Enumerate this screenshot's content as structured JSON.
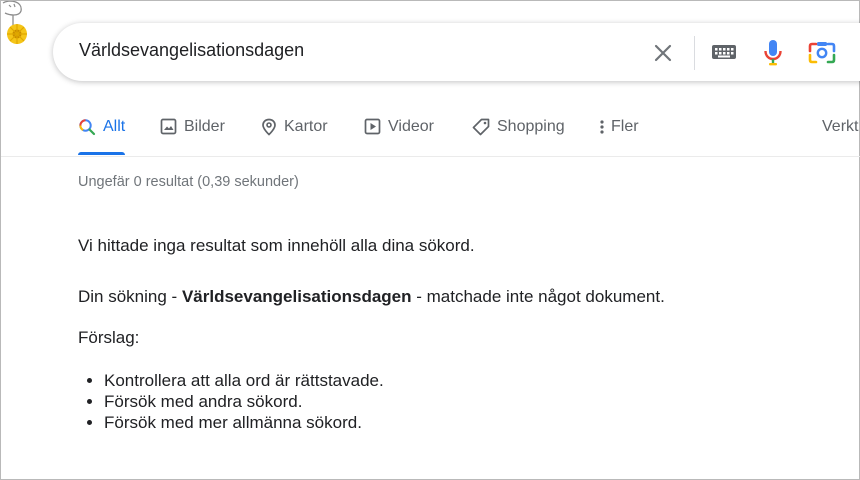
{
  "search": {
    "query": "Världsevangelisationsdagen"
  },
  "tabs": [
    {
      "label": "Allt",
      "icon": "search-icon",
      "active": true
    },
    {
      "label": "Bilder",
      "icon": "image-icon"
    },
    {
      "label": "Kartor",
      "icon": "map-pin-icon"
    },
    {
      "label": "Videor",
      "icon": "play-icon"
    },
    {
      "label": "Shopping",
      "icon": "tag-icon"
    },
    {
      "label": "Fler",
      "icon": "more-vert-icon"
    },
    {
      "label": "Verkt"
    }
  ],
  "results": {
    "stats": "Ungefär 0 resultat (0,39 sekunder)",
    "no_results": "Vi hittade inga resultat som innehöll alla dina sökord.",
    "your_search_prefix": "Din sökning - ",
    "your_search_term": "Världsevangelisationsdagen",
    "your_search_suffix": " - matchade inte något dokument.",
    "suggestions_heading": "Förslag:",
    "suggestions": [
      "Kontrollera att alla ord är rättstavade.",
      "Försök med andra sökord.",
      "Försök med mer allmänna sökord."
    ]
  },
  "colors": {
    "accent": "#1a73e8",
    "text": "#202124",
    "muted": "#70757a"
  }
}
